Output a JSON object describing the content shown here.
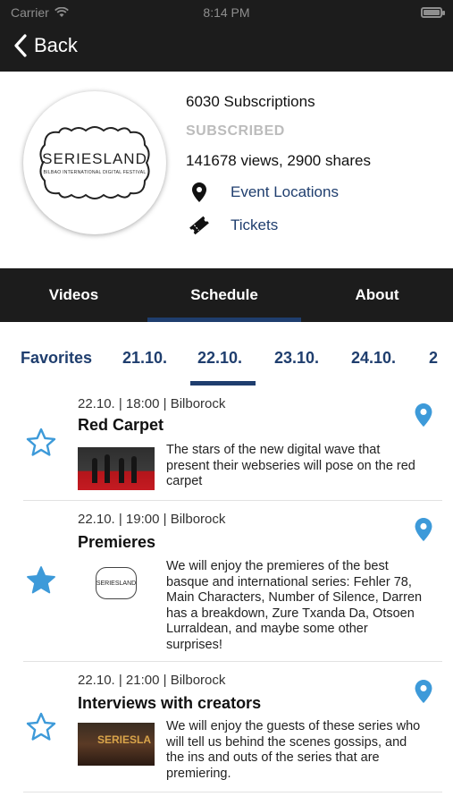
{
  "status_bar": {
    "carrier": "Carrier",
    "time": "8:14 PM",
    "battery_level": 1.0
  },
  "nav": {
    "back_label": "Back"
  },
  "profile": {
    "logo_text": "SERIESLAND",
    "logo_subtext": "BILBAO INTERNATIONAL DIGITAL FESTIVAL",
    "subscriptions": "6030 Subscriptions",
    "subscribed_label": "SUBSCRIBED",
    "views_shares": "141678 views, 2900 shares",
    "event_locations_label": "Event Locations",
    "tickets_label": "Tickets"
  },
  "tabs": [
    {
      "label": "Videos",
      "active": false
    },
    {
      "label": "Schedule",
      "active": true
    },
    {
      "label": "About",
      "active": false
    }
  ],
  "date_tabs": [
    {
      "label": "Favorites",
      "active": false
    },
    {
      "label": "21.10.",
      "active": false
    },
    {
      "label": "22.10.",
      "active": true
    },
    {
      "label": "23.10.",
      "active": false
    },
    {
      "label": "24.10.",
      "active": false
    },
    {
      "label": "2",
      "active": false
    }
  ],
  "events": [
    {
      "meta": "22.10. | 18:00 | Bilborock",
      "title": "Red Carpet",
      "description": "The stars of the new digital wave that present their webseries will pose on the red carpet",
      "favorite": false
    },
    {
      "meta": "22.10. | 19:00 | Bilborock",
      "title": "Premieres",
      "description": "We will enjoy the premieres of the best basque and international series: Fehler 78, Main Characters, Number of Silence, Darren has a breakdown, Zure Txanda Da, Otsoen Lurraldean, and maybe some other surprises!",
      "favorite": true,
      "thumb_logo_text": "SERIESLAND"
    },
    {
      "meta": "22.10. | 21:00 | Bilborock",
      "title": "Interviews with creators",
      "description": "We will enjoy the guests of these series who will tell us behind the scenes gossips, and the ins and outs of the series that are premiering.",
      "favorite": false,
      "thumb_sign_text": "SERIESLA"
    }
  ],
  "colors": {
    "header_bg": "#1c1c1c",
    "accent_navy": "#1f3e6e",
    "star_blue": "#3d9ad9",
    "subscribed_gray": "#bcbcbc"
  }
}
